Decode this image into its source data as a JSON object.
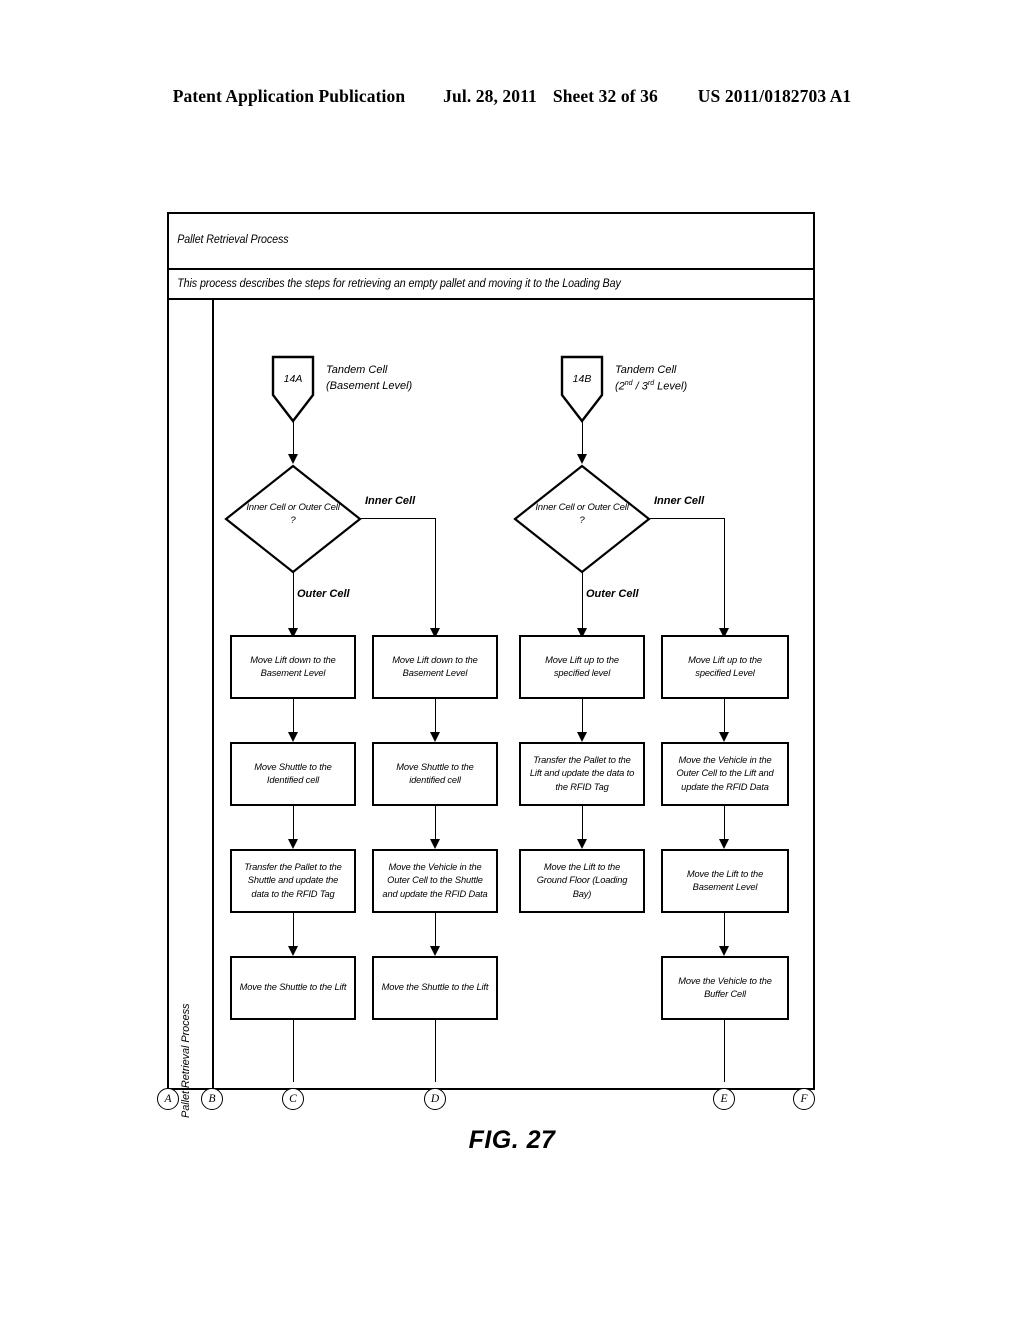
{
  "patent_header": {
    "publication": "Patent Application Publication",
    "date": "Jul. 28, 2011",
    "sheet": "Sheet 32 of 36",
    "number": "US 2011/0182703 A1"
  },
  "figure": {
    "caption": "FIG. 27",
    "title": "Pallet Retrieval Process",
    "subtitle": "This process describes the steps for retrieving an empty pallet and moving it to the Loading Bay",
    "lane_label": "Pallet Retrieval Process"
  },
  "starts": [
    {
      "id": "14A",
      "caption_line1": "Tandem Cell",
      "caption_line2": "(Basement Level)"
    },
    {
      "id": "14B",
      "caption_line1": "Tandem Cell",
      "caption_line2_pre": "(2",
      "caption_line2_sup1": "nd",
      "caption_line2_mid": " / 3",
      "caption_line2_sup2": "rd",
      "caption_line2_post": " Level)"
    }
  ],
  "decisions": [
    {
      "line1": "Inner Cell or Outer Cell",
      "line2": "?",
      "branch_right": "Inner Cell",
      "branch_down": "Outer Cell"
    },
    {
      "line1": "Inner Cell or Outer Cell",
      "line2": "?",
      "branch_right": "Inner Cell",
      "branch_down": "Outer Cell"
    }
  ],
  "columns": [
    {
      "name": "col1-outer-cell-basement",
      "steps": [
        "Move Lift down to the Basement Level",
        "Move Shuttle to the Identified cell",
        "Transfer the Pallet to the Shuttle and update the data to the RFID Tag",
        "Move the Shuttle to the Lift"
      ]
    },
    {
      "name": "col2-inner-cell-basement",
      "steps": [
        "Move Lift down to the Basement Level",
        "Move Shuttle to the identified cell",
        "Move the Vehicle in the Outer Cell to the Shuttle and update the RFID Data",
        "Move the Shuttle to the Lift"
      ]
    },
    {
      "name": "col3-outer-cell-upper",
      "steps": [
        "Move Lift up to the specified level",
        "Transfer the Pallet to the Lift and update the data to the RFID Tag",
        "Move the Lift to the Ground Floor (Loading Bay)"
      ]
    },
    {
      "name": "col4-inner-cell-upper",
      "steps": [
        "Move Lift up to the specified Level",
        "Move the Vehicle in the Outer Cell to the Lift and update the RFID Data",
        "Move the Lift to the Basement Level",
        "Move the Vehicle to the Buffer Cell"
      ]
    }
  ],
  "connectors": [
    {
      "label": "A"
    },
    {
      "label": "B"
    },
    {
      "label": "C"
    },
    {
      "label": "D"
    },
    {
      "label": "E"
    },
    {
      "label": "F"
    }
  ]
}
